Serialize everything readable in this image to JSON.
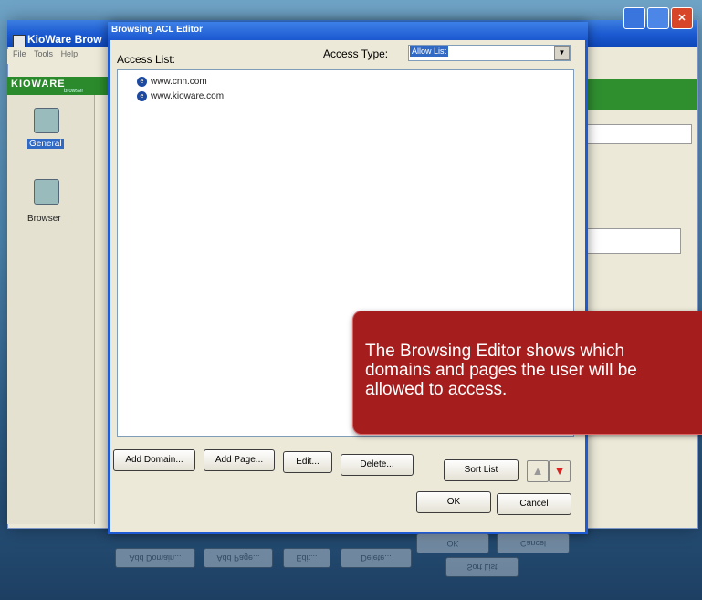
{
  "background_window": {
    "title": "KioWare Brow",
    "menu": [
      "File",
      "Tools",
      "Help"
    ],
    "brand_logo": "KIOWARE",
    "brand_sub": "browser",
    "nav": [
      {
        "label": "General",
        "selected": true
      },
      {
        "label": "Browser",
        "selected": false
      }
    ]
  },
  "dialog": {
    "title": "Browsing ACL Editor",
    "access_list_label": "Access List:",
    "access_type_label": "Access Type:",
    "access_type_value": "Allow List",
    "items": [
      "www.cnn.com",
      "www.kioware.com"
    ],
    "buttons": {
      "add_domain": "Add Domain...",
      "add_page": "Add Page...",
      "edit": "Edit...",
      "delete": "Delete...",
      "sort_list": "Sort List",
      "ok": "OK",
      "cancel": "Cancel"
    }
  },
  "callout": {
    "text": "The Browsing Editor shows which domains and pages the user will be allowed to access."
  },
  "colors": {
    "callout_bg": "#a51d1d",
    "title_blue": "#1d5ad4",
    "brand_green": "#2b8a2b"
  }
}
